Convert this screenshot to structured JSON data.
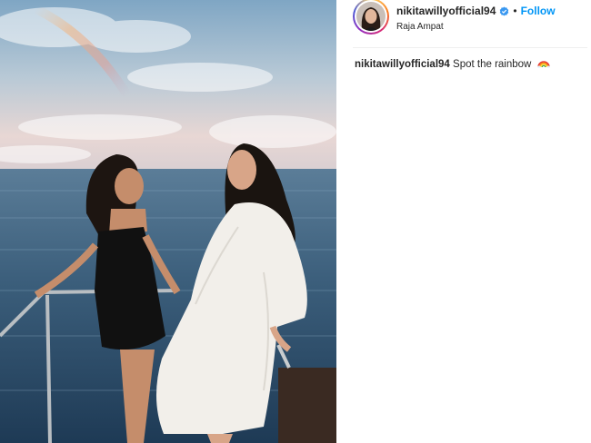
{
  "post": {
    "username": "nikitawillyofficial94",
    "location": "Raja Ampat",
    "follow_label": "Follow",
    "separator": "•",
    "caption": {
      "username": "nikitawillyofficial94",
      "text": "Spot the rainbow"
    }
  },
  "icons": {
    "verified": "verified-badge-icon",
    "caption_emoji": "rainbow-emoji-icon"
  },
  "colors": {
    "follow": "#0095f6",
    "verified": "#3897f0"
  }
}
